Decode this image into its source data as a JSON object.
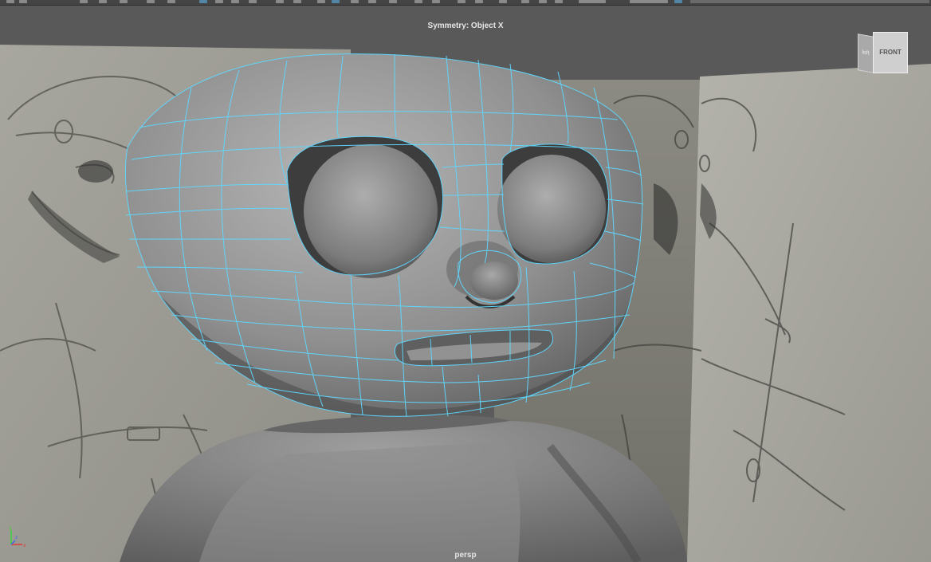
{
  "viewport": {
    "symmetry_label": "Symmetry: Object X",
    "camera_label": "persp"
  },
  "viewcube": {
    "front_label": "FRONT",
    "side_label": "left"
  },
  "axis_gizmo": {
    "x_label": "x",
    "y_label": "y",
    "z_label": "z"
  },
  "colors": {
    "wireframe": "#5fd8ff",
    "selected_tool": "#5285a6"
  },
  "icons": [
    "tool-icon",
    "select-icon",
    "move-icon",
    "rotate-icon",
    "scale-icon",
    "snap-icon",
    "symmetry-icon"
  ]
}
